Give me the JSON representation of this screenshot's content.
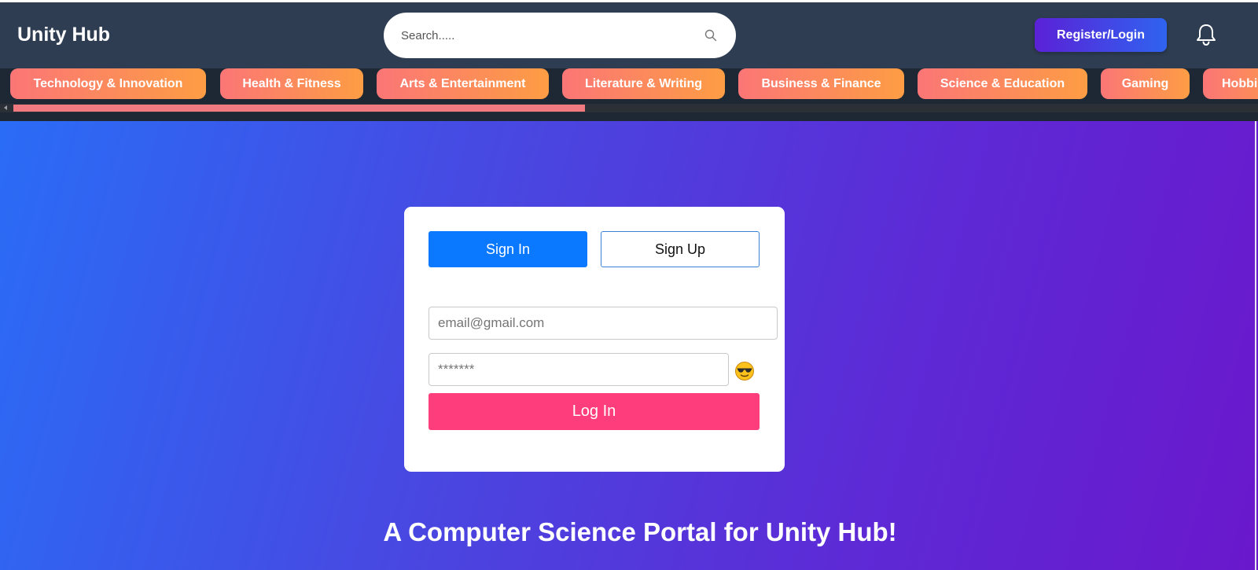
{
  "header": {
    "logo": "Unity Hub",
    "search_placeholder": "Search.....",
    "register_label": "Register/Login"
  },
  "categories": [
    "Technology & Innovation",
    "Health & Fitness",
    "Arts & Entertainment",
    "Literature & Writing",
    "Business & Finance",
    "Science & Education",
    "Gaming",
    "Hobbi"
  ],
  "auth": {
    "signin_tab": "Sign In",
    "signup_tab": "Sign Up",
    "email_placeholder": "email@gmail.com",
    "password_placeholder": "*******",
    "login_label": "Log In"
  },
  "tagline": "A Computer Science Portal for Unity Hub!",
  "colors": {
    "header_bg": "#2e3d52",
    "category_gradient": [
      "#fb7676",
      "#fd9d44"
    ],
    "register_gradient": [
      "#5b21d6",
      "#2f63f0"
    ],
    "hero_gradient": [
      "#2a6cf6",
      "#6a18cc"
    ],
    "signin_tab": "#0a79ff",
    "login_button": "#fe3d7c"
  }
}
